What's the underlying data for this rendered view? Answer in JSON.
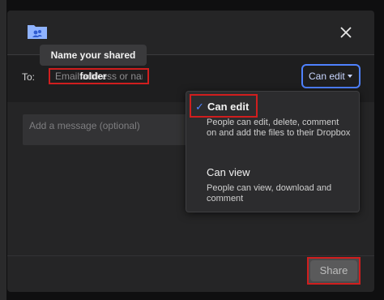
{
  "dialog": {
    "tooltip": "Name your shared folder",
    "to_label": "To:",
    "recipient_placeholder": "Email address or name",
    "permission_selected": "Can edit",
    "message_placeholder": "Add a message (optional)",
    "share_label": "Share"
  },
  "permission_menu": {
    "options": [
      {
        "label": "Can edit",
        "selected": true,
        "description": "People can edit, delete, comment on and add the files to their Dropbox"
      },
      {
        "label": "Can view",
        "selected": false,
        "description": "People can view, download and comment"
      }
    ]
  },
  "colors": {
    "accent": "#4f82ff",
    "highlight": "#d01e1e",
    "dialog_bg": "#252526"
  },
  "icons": [
    "shared-folder-icon",
    "close-icon",
    "chevron-down-icon",
    "check-icon"
  ]
}
